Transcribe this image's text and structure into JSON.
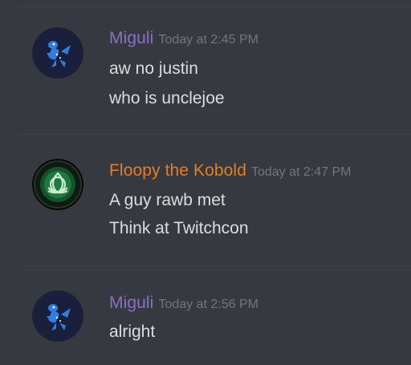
{
  "messages": [
    {
      "username": "Miguli",
      "timestamp": "Today at 2:45 PM",
      "user_color": "#8b70c8",
      "avatar_icon": "blue-kobold-avatar-icon",
      "lines": [
        "aw no justin",
        "who is unclejoe"
      ]
    },
    {
      "username": "Floopy the Kobold",
      "timestamp": "Today at 2:47 PM",
      "user_color": "#e67e22",
      "avatar_icon": "green-triquetra-avatar-icon",
      "lines": [
        "A guy rawb met",
        "Think at Twitchcon"
      ]
    },
    {
      "username": "Miguli",
      "timestamp": "Today at 2:56 PM",
      "user_color": "#8b70c8",
      "avatar_icon": "blue-kobold-avatar-icon",
      "lines": [
        "alright"
      ]
    }
  ]
}
